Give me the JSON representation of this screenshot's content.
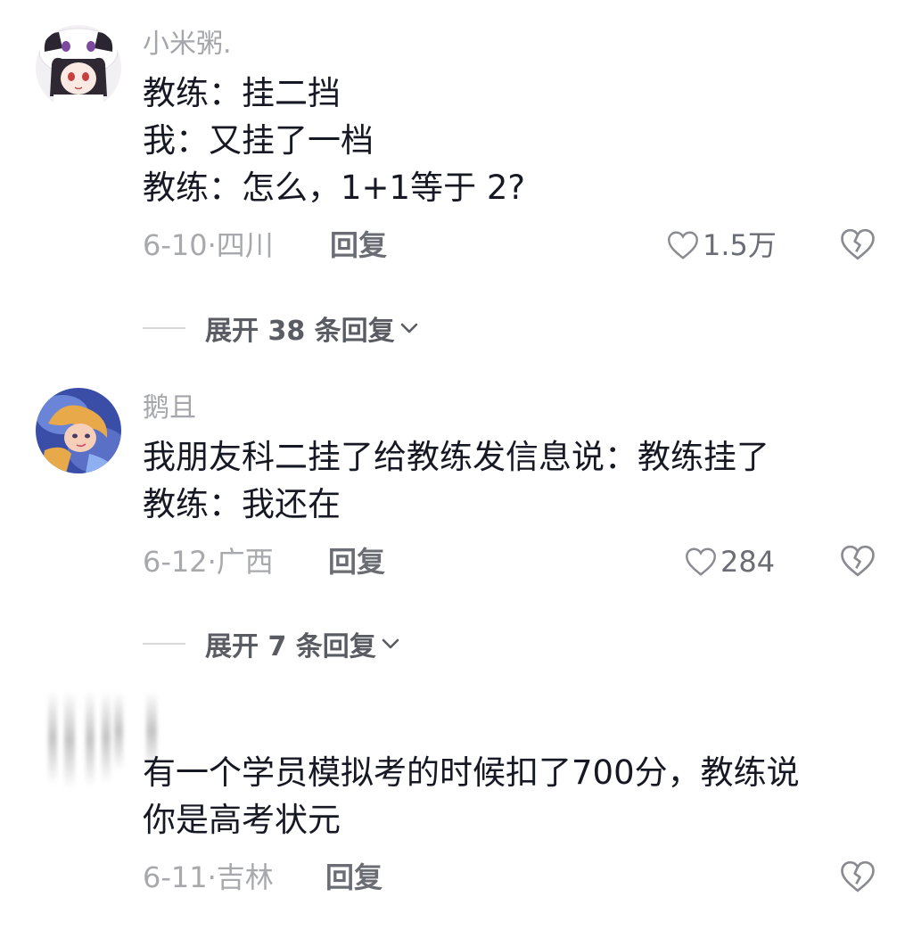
{
  "comments": [
    {
      "username": "小米粥.",
      "lines": [
        "教练：挂二挡",
        "我：又挂了一档",
        "教练：怎么，1+1等于 2?"
      ],
      "date": "6-10·",
      "location": "四川",
      "reply_label": "回复",
      "likes": "1.5万",
      "expand_label": "展开 38 条回复"
    },
    {
      "username": "鹅且",
      "lines": [
        "我朋友科二挂了给教练发信息说：教练挂了",
        "教练：我还在"
      ],
      "date": "6-12·",
      "location": "广西",
      "reply_label": "回复",
      "likes": "284",
      "expand_label": "展开 7 条回复"
    },
    {
      "username": "",
      "lines": [
        "有一个学员模拟考的时候扣了700分，教练说",
        "你是高考状元"
      ],
      "date": "6-11·",
      "location": "吉林",
      "reply_label": "回复",
      "likes": ""
    }
  ],
  "icons": {
    "like": "heart-outline-icon",
    "dislike": "broken-heart-icon",
    "expand": "chevron-down-icon"
  },
  "colors": {
    "text": "#161823",
    "secondary": "#a4a6ab",
    "action": "#6b6d74"
  }
}
